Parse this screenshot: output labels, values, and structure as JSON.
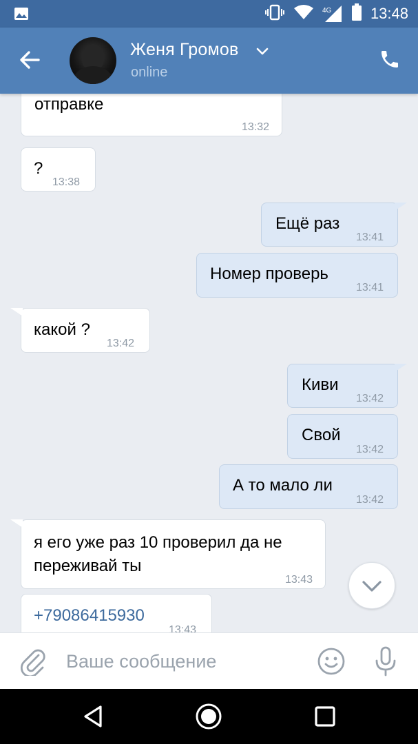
{
  "status_bar": {
    "network": "4G",
    "time": "13:48",
    "icons": [
      "gallery-icon",
      "vibrate-icon",
      "wifi-icon",
      "signal-icon",
      "battery-icon"
    ]
  },
  "header": {
    "contact_name": "Женя Громов",
    "contact_status": "online",
    "icons": [
      "back-arrow-icon",
      "chevron-down-icon",
      "phone-icon"
    ]
  },
  "messages": [
    {
      "dir": "in",
      "text": "и все данные преготовил к\nотправке",
      "time": "13:32"
    },
    {
      "dir": "in",
      "text": "?",
      "time": "13:38"
    },
    {
      "dir": "out",
      "text": "Ещё раз",
      "time": "13:41"
    },
    {
      "dir": "out",
      "text": "Номер проверь",
      "time": "13:41"
    },
    {
      "dir": "in",
      "text": "какой ?",
      "time": "13:42"
    },
    {
      "dir": "out",
      "text": "Киви",
      "time": "13:42"
    },
    {
      "dir": "out",
      "text": "Свой",
      "time": "13:42"
    },
    {
      "dir": "out",
      "text": "А то мало ли",
      "time": "13:42"
    },
    {
      "dir": "in",
      "text": "я его уже раз 10 проверил да не\nпереживай ты",
      "time": "13:43"
    },
    {
      "dir": "in",
      "text": "+79086415930",
      "time": "13:43",
      "link": true
    }
  ],
  "composer": {
    "placeholder": "Ваше сообщение",
    "icons": [
      "paperclip-icon",
      "emoji-icon",
      "microphone-icon"
    ]
  },
  "scroll_button_icon": "chevron-down-icon",
  "nav_bar": {
    "icons": [
      "back-triangle-icon",
      "home-circle-icon",
      "recents-square-icon"
    ]
  },
  "colors": {
    "header": "#5181b8",
    "status_bar": "#3e6aa0",
    "chat_bg": "#eaedf2",
    "bubble_out": "#dde8f6",
    "bubble_in": "#ffffff",
    "link": "#3d6a9d"
  }
}
